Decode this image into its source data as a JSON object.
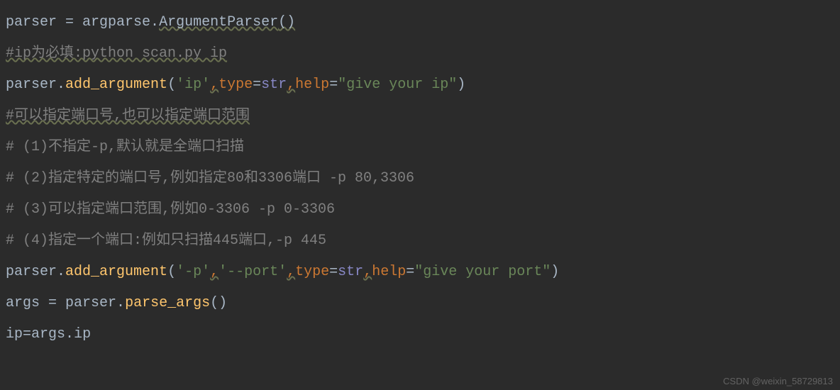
{
  "code": {
    "l1_parser": "parser",
    "l1_eq": " = ",
    "l1_argparse": "argparse",
    "l1_dot": ".",
    "l1_ArgumentParser": "ArgumentParser",
    "l1_parens": "()",
    "l2_comment": "#ip为必填:python scan.py ip",
    "l3_parser": "parser",
    "l3_dot": ".",
    "l3_add": "add_argument",
    "l3_open": "(",
    "l3_str_ip": "'ip'",
    "l3_type_kw": "type",
    "l3_eq1": "=",
    "l3_str_builtin": "str",
    "l3_help_kw": "help",
    "l3_eq2": "=",
    "l3_str_help": "\"give your ip\"",
    "l3_close": ")",
    "l4_comment": "#可以指定端口号,也可以指定端口范围",
    "l5_comment": "# (1)不指定-p,默认就是全端口扫描",
    "l6_comment": "# (2)指定特定的端口号,例如指定80和3306端口 -p 80,3306",
    "l7_comment": "# (3)可以指定端口范围,例如0-3306 -p 0-3306",
    "l8_comment": "# (4)指定一个端口:例如只扫描445端口,-p 445",
    "l9_parser": "parser",
    "l9_dot": ".",
    "l9_add": "add_argument",
    "l9_open": "(",
    "l9_str_p": "'-p'",
    "l9_str_port": "'--port'",
    "l9_type_kw": "type",
    "l9_eq1": "=",
    "l9_str_builtin": "str",
    "l9_help_kw": "help",
    "l9_eq2": "=",
    "l9_str_help": "\"give your port\"",
    "l9_close": ")",
    "l10_args": "args",
    "l10_eq": " = ",
    "l10_parser": "parser",
    "l10_dot": ".",
    "l10_parse": "parse_args",
    "l10_parens": "()",
    "l11_ip": "ip",
    "l11_eq": "=",
    "l11_args": "args",
    "l11_dot": ".",
    "l11_ipattr": "ip",
    "comma": ","
  },
  "watermark": "CSDN @weixin_58729813"
}
